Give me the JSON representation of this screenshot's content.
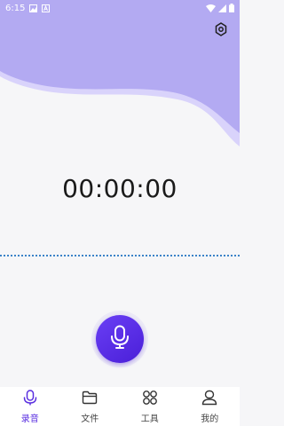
{
  "status_bar": {
    "time": "6:15",
    "icons": [
      "gallery-icon",
      "a-icon",
      "wifi-icon",
      "signal-icon",
      "battery-icon"
    ]
  },
  "header": {
    "settings_icon": "gear-icon"
  },
  "recorder": {
    "timer": "00:00:00",
    "mic_icon": "microphone-icon"
  },
  "colors": {
    "accent": "#5a2fe0",
    "header_purple": "#b3aaf2",
    "waveform_blue": "#3b83c8"
  },
  "nav": {
    "items": [
      {
        "label": "录音",
        "icon": "microphone-icon",
        "active": true
      },
      {
        "label": "文件",
        "icon": "folder-icon",
        "active": false
      },
      {
        "label": "工具",
        "icon": "tools-grid-icon",
        "active": false
      },
      {
        "label": "我的",
        "icon": "profile-icon",
        "active": false
      }
    ]
  }
}
